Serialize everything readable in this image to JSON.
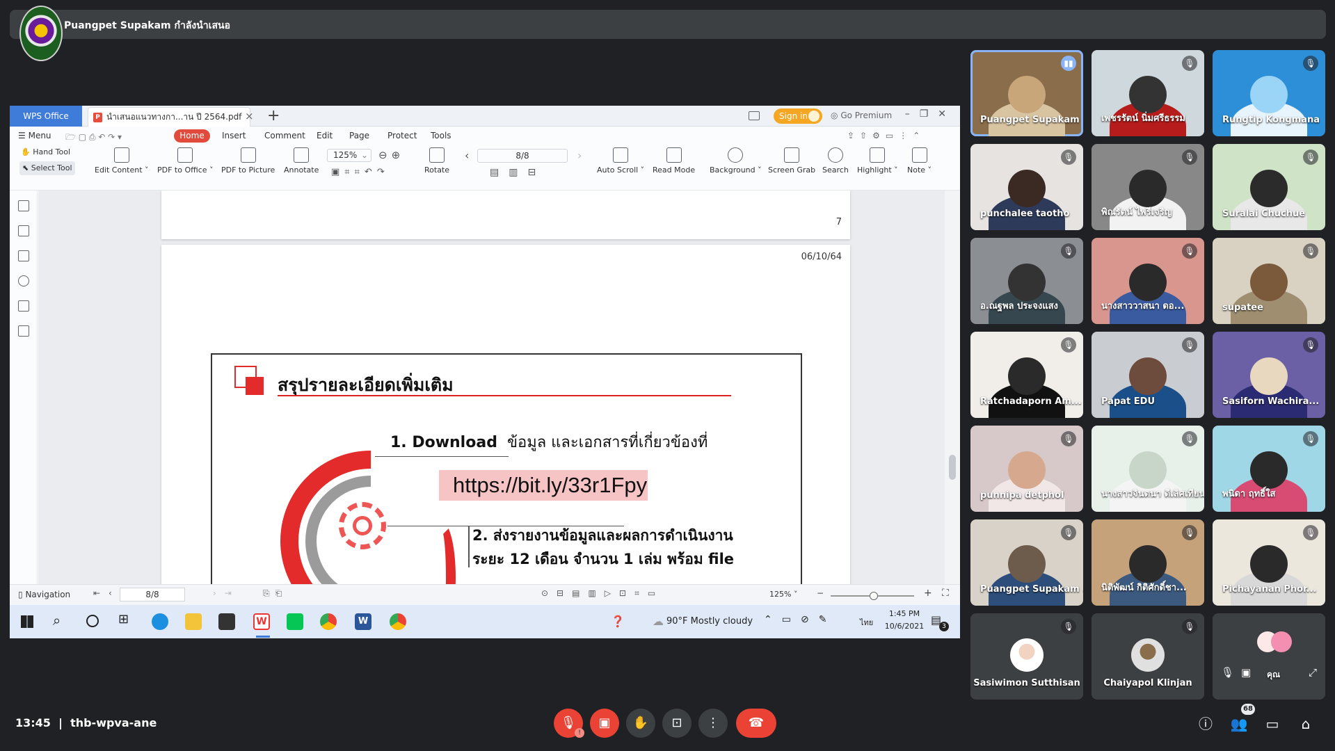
{
  "meet": {
    "presenter_name": "Puangpet Supakam กำลังนำเสนอ",
    "time": "13:45",
    "separator": "|",
    "meeting_code": "thb-wpva-ane",
    "people_badge": "68"
  },
  "wps": {
    "brand": "WPS Office",
    "tab_title": "นำเสนอแนวทางกา...าน ปี 2564.pdf",
    "sign_in": "Sign in",
    "go_premium": "Go Premium",
    "menu": {
      "menu": "Menu",
      "home": "Home",
      "insert": "Insert",
      "comment": "Comment",
      "edit": "Edit",
      "page": "Page",
      "protect": "Protect",
      "tools": "Tools"
    },
    "toolbar": {
      "hand_tool": "Hand Tool",
      "select_tool": "Select Tool",
      "edit_content": "Edit Content ˅",
      "pdf_to_office": "PDF to Office ˅",
      "pdf_to_picture": "PDF to Picture",
      "annotate": "Annotate",
      "zoom": "125%",
      "rotate": "Rotate",
      "page": "8/8",
      "auto_scroll": "Auto Scroll ˅",
      "read_mode": "Read Mode",
      "background": "Background ˅",
      "screen_grab": "Screen Grab",
      "search": "Search",
      "highlight": "Highlight ˅",
      "note": "Note ˅"
    },
    "doc": {
      "prev_page_number": "7",
      "date": "06/10/64",
      "slide_title": "สรุปรายละเอียดเพิ่มเติม",
      "item1_en": "1. Download",
      "item1_th": "ข้อมูล และเอกสารที่เกี่ยวข้องที่",
      "link": "https://bit.ly/33r1Fpy",
      "item2": "2. ส่งรายงานข้อมูลและผลการดำเนินงาน",
      "item2_cut": "ระยะ 12 เดือน จำนวน 1 เล่ม พร้อม file"
    },
    "navbar": {
      "navigation": "Navigation",
      "page": "8/8",
      "zoom": "125% ˅"
    }
  },
  "taskbar": {
    "weather": "90°F  Mostly cloudy",
    "lang": "ไทย",
    "time": "1:45 PM",
    "date": "10/6/2021",
    "notif_count": "3"
  },
  "participants": [
    {
      "name": "Puangpet Supakam"
    },
    {
      "name": "เพชรรัตน์ นิ่มศรีธรรม"
    },
    {
      "name": "Rungtip Kongmana"
    },
    {
      "name": "punchalee taotho"
    },
    {
      "name": "พิณรัตน์ ไพรีเจริญ"
    },
    {
      "name": "Suralai Chuchue"
    },
    {
      "name": "อ.ณฐพล ประจงแสง"
    },
    {
      "name": "นางสาววาสนา ดอ..."
    },
    {
      "name": "supatee"
    },
    {
      "name": "Ratchadaporn Am..."
    },
    {
      "name": "Papat EDU"
    },
    {
      "name": "Sasiforn Wachira..."
    },
    {
      "name": "punnipa detphol"
    },
    {
      "name": "นางสาวจินตนา ดีเลิศเทียน"
    },
    {
      "name": "พนิดา ฤทธิ์ใส"
    },
    {
      "name": "Puangpet Supakam ..."
    },
    {
      "name": "นิติพัฒน์ กิติศักดิ์ชา..."
    },
    {
      "name": "Pichayanan Phor..."
    },
    {
      "name": "Sasiwimon Sutthisan"
    },
    {
      "name": "Chaiyapol Klinjan"
    },
    {
      "name": "คุณ"
    }
  ],
  "colors": {
    "meet_bg": "#202124",
    "wps_blue": "#3f7bd8",
    "home_red": "#e24a3b",
    "end_red": "#ea4335",
    "link_bg": "#f6c4c4"
  }
}
